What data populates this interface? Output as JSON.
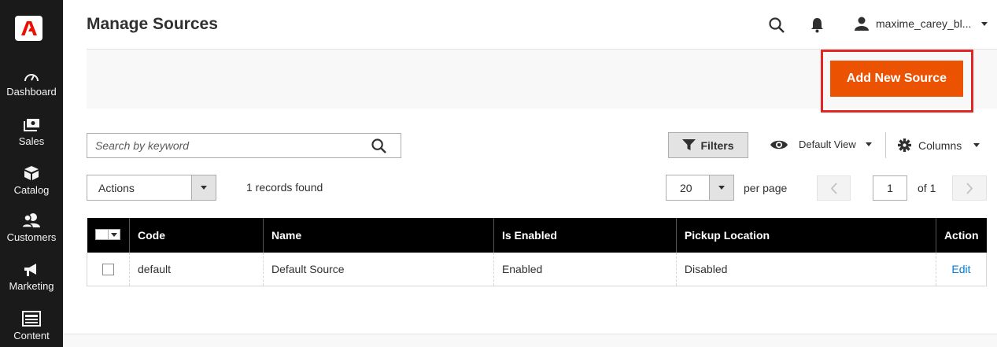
{
  "sidebar": {
    "items": [
      {
        "label": "Dashboard",
        "icon": "dashboard-icon"
      },
      {
        "label": "Sales",
        "icon": "sales-icon"
      },
      {
        "label": "Catalog",
        "icon": "catalog-icon"
      },
      {
        "label": "Customers",
        "icon": "customers-icon"
      },
      {
        "label": "Marketing",
        "icon": "marketing-icon"
      },
      {
        "label": "Content",
        "icon": "content-icon"
      }
    ]
  },
  "header": {
    "title": "Manage Sources",
    "username": "maxime_carey_bl..."
  },
  "actions_bar": {
    "add_label": "Add New Source"
  },
  "toolbar": {
    "search_placeholder": "Search by keyword",
    "filters_label": "Filters",
    "view_label": "Default View",
    "columns_label": "Columns",
    "mass_actions_label": "Actions",
    "records_found": "1 records found",
    "per_page_value": "20",
    "per_page_label": "per page",
    "current_page": "1",
    "page_of": "of 1"
  },
  "grid": {
    "columns": [
      "Code",
      "Name",
      "Is Enabled",
      "Pickup Location",
      "Action"
    ],
    "rows": [
      {
        "code": "default",
        "name": "Default Source",
        "enabled": "Enabled",
        "pickup": "Disabled",
        "action": "Edit"
      }
    ]
  },
  "colors": {
    "sidebar_bg": "#1a1a1a",
    "primary_button": "#eb5202",
    "highlight_border": "#e22626",
    "link": "#007bdb"
  }
}
